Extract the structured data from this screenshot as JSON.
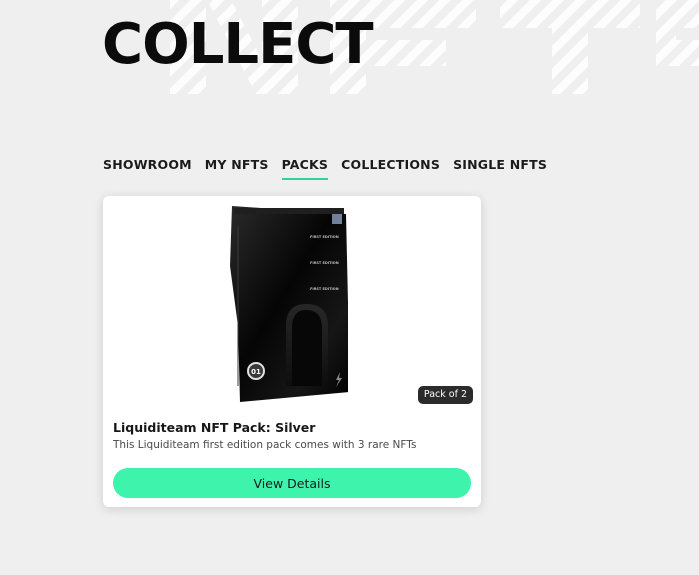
{
  "header": {
    "title": "COLLECT",
    "watermark_text": "NFTS"
  },
  "tabs": [
    {
      "label": "SHOWROOM",
      "active": false
    },
    {
      "label": "MY NFTS",
      "active": false
    },
    {
      "label": "PACKS",
      "active": true
    },
    {
      "label": "COLLECTIONS",
      "active": false
    },
    {
      "label": "SINGLE NFTS",
      "active": false
    }
  ],
  "card": {
    "badge": "Pack of 2",
    "title": "Liquiditeam NFT Pack: Silver",
    "description": "This Liquiditeam first edition pack comes with 3 rare NFTs",
    "button_label": "View Details",
    "pack_text": "FIRST EDITION",
    "pack_logo": "01"
  },
  "colors": {
    "accent": "#3ef4ad",
    "tab_underline": "#2fd39c",
    "background": "#efefef"
  }
}
